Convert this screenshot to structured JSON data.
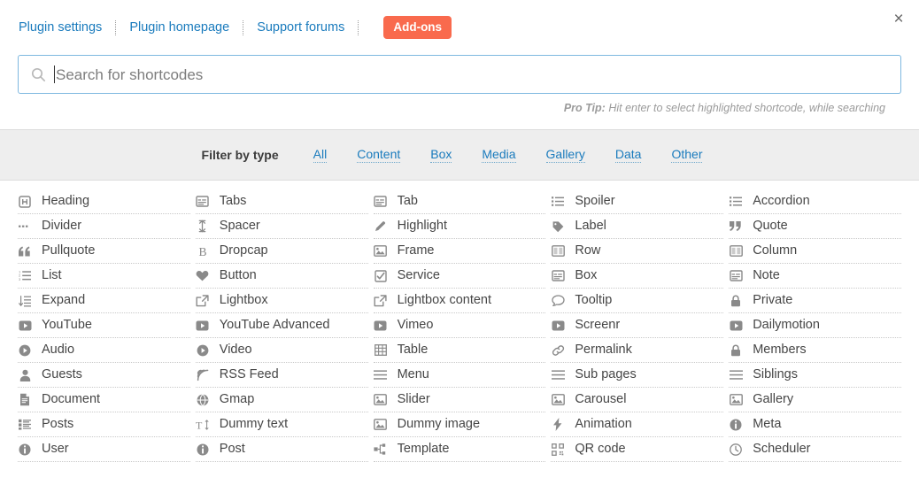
{
  "header": {
    "nav": [
      {
        "label": "Plugin settings",
        "name": "plugin-settings"
      },
      {
        "label": "Plugin homepage",
        "name": "plugin-homepage"
      },
      {
        "label": "Support forums",
        "name": "support-forums"
      }
    ],
    "addons_button": "Add-ons",
    "close_icon": "×",
    "accent_color": "#f96a4d",
    "link_color": "#1a7bbd"
  },
  "search": {
    "value": "",
    "placeholder": "Search for shortcodes",
    "icon": "search-icon",
    "border_color": "#7eb8e0",
    "protip_label": "Pro Tip:",
    "protip_text": "Hit enter to select highlighted shortcode, while searching"
  },
  "filter": {
    "label": "Filter by type",
    "options": [
      {
        "label": "All",
        "name": "all"
      },
      {
        "label": "Content",
        "name": "content"
      },
      {
        "label": "Box",
        "name": "box"
      },
      {
        "label": "Media",
        "name": "media"
      },
      {
        "label": "Gallery",
        "name": "gallery"
      },
      {
        "label": "Data",
        "name": "data"
      },
      {
        "label": "Other",
        "name": "other"
      }
    ],
    "background_color": "#eeeeee"
  },
  "shortcodes": [
    {
      "label": "Heading",
      "icon": "heading-icon"
    },
    {
      "label": "Tabs",
      "icon": "tabs-icon"
    },
    {
      "label": "Tab",
      "icon": "tab-icon"
    },
    {
      "label": "Spoiler",
      "icon": "list-bullets-icon"
    },
    {
      "label": "Accordion",
      "icon": "list-bullets-icon"
    },
    {
      "label": "Divider",
      "icon": "dots-icon"
    },
    {
      "label": "Spacer",
      "icon": "arrows-vertical-icon"
    },
    {
      "label": "Highlight",
      "icon": "pencil-icon"
    },
    {
      "label": "Label",
      "icon": "tag-icon"
    },
    {
      "label": "Quote",
      "icon": "quote-right-icon"
    },
    {
      "label": "Pullquote",
      "icon": "quote-left-icon"
    },
    {
      "label": "Dropcap",
      "icon": "bold-b-icon"
    },
    {
      "label": "Frame",
      "icon": "image-icon"
    },
    {
      "label": "Row",
      "icon": "columns-icon"
    },
    {
      "label": "Column",
      "icon": "columns-icon"
    },
    {
      "label": "List",
      "icon": "ordered-list-icon"
    },
    {
      "label": "Button",
      "icon": "heart-icon"
    },
    {
      "label": "Service",
      "icon": "checkbox-icon"
    },
    {
      "label": "Box",
      "icon": "tabs-icon"
    },
    {
      "label": "Note",
      "icon": "tabs-icon"
    },
    {
      "label": "Expand",
      "icon": "sort-list-icon"
    },
    {
      "label": "Lightbox",
      "icon": "external-link-icon"
    },
    {
      "label": "Lightbox content",
      "icon": "external-link-icon"
    },
    {
      "label": "Tooltip",
      "icon": "comment-icon"
    },
    {
      "label": "Private",
      "icon": "lock-icon"
    },
    {
      "label": "YouTube",
      "icon": "play-box-icon"
    },
    {
      "label": "YouTube Advanced",
      "icon": "play-box-icon"
    },
    {
      "label": "Vimeo",
      "icon": "play-box-icon"
    },
    {
      "label": "Screenr",
      "icon": "play-box-icon"
    },
    {
      "label": "Dailymotion",
      "icon": "play-box-icon"
    },
    {
      "label": "Audio",
      "icon": "play-circle-icon"
    },
    {
      "label": "Video",
      "icon": "play-circle-icon"
    },
    {
      "label": "Table",
      "icon": "table-icon"
    },
    {
      "label": "Permalink",
      "icon": "link-icon"
    },
    {
      "label": "Members",
      "icon": "lock-icon"
    },
    {
      "label": "Guests",
      "icon": "user-icon"
    },
    {
      "label": "RSS Feed",
      "icon": "rss-icon"
    },
    {
      "label": "Menu",
      "icon": "hamburger-icon"
    },
    {
      "label": "Sub pages",
      "icon": "hamburger-icon"
    },
    {
      "label": "Siblings",
      "icon": "hamburger-icon"
    },
    {
      "label": "Document",
      "icon": "document-icon"
    },
    {
      "label": "Gmap",
      "icon": "globe-icon"
    },
    {
      "label": "Slider",
      "icon": "image-icon"
    },
    {
      "label": "Carousel",
      "icon": "image-icon"
    },
    {
      "label": "Gallery",
      "icon": "image-icon"
    },
    {
      "label": "Posts",
      "icon": "list-blocks-icon"
    },
    {
      "label": "Dummy text",
      "icon": "text-height-icon"
    },
    {
      "label": "Dummy image",
      "icon": "image-icon"
    },
    {
      "label": "Animation",
      "icon": "bolt-icon"
    },
    {
      "label": "Meta",
      "icon": "info-circle-icon"
    },
    {
      "label": "User",
      "icon": "info-circle-icon"
    },
    {
      "label": "Post",
      "icon": "info-circle-icon"
    },
    {
      "label": "Template",
      "icon": "sitemap-icon"
    },
    {
      "label": "QR code",
      "icon": "qrcode-icon"
    },
    {
      "label": "Scheduler",
      "icon": "clock-icon"
    }
  ]
}
